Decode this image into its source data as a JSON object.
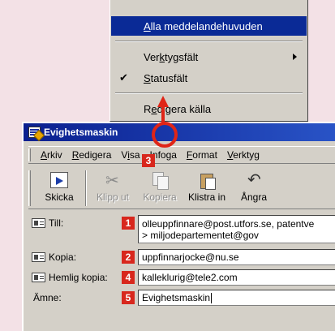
{
  "colors": {
    "background": "#f3e1e6",
    "window_chrome": "#d4d0c8",
    "titlebar": "#0a1f8f",
    "menu_highlight": "#0a2a96",
    "callout_red": "#d8271d"
  },
  "dropdown": {
    "items": [
      {
        "label": "Alla meddelandehuvuden",
        "highlighted": true
      },
      {
        "label": "Verktygsfält",
        "has_submenu": true
      },
      {
        "label": "Statusfält",
        "checked": true
      },
      {
        "label": "Redigera källa"
      }
    ]
  },
  "window": {
    "title": "Evighetsmaskin",
    "menu": [
      "Arkiv",
      "Redigera",
      "Visa",
      "Infoga",
      "Format",
      "Verktyg"
    ],
    "toolbar": [
      {
        "label": "Skicka",
        "icon": "send-icon",
        "enabled": true
      },
      {
        "label": "Klipp ut",
        "icon": "scissors-icon",
        "enabled": false
      },
      {
        "label": "Kopiera",
        "icon": "copy-icon",
        "enabled": false
      },
      {
        "label": "Klistra in",
        "icon": "paste-icon",
        "enabled": true
      },
      {
        "label": "Ångra",
        "icon": "undo-icon",
        "enabled": true
      }
    ],
    "fields": {
      "to": {
        "label": "Till:",
        "badge": "1",
        "line1": "olleuppfinnare@post.utfors.se, patentve",
        "line2": "> miljodepartementet@gov"
      },
      "cc": {
        "label": "Kopia:",
        "badge": "2",
        "value": "uppfinnarjocke@nu.se"
      },
      "bcc": {
        "label": "Hemlig kopia:",
        "badge": "4",
        "value": "kalleklurig@tele2.com"
      },
      "subject": {
        "label": "Ämne:",
        "badge": "5",
        "value": "Evighetsmaskin"
      }
    }
  },
  "callout": {
    "badge": "3"
  }
}
